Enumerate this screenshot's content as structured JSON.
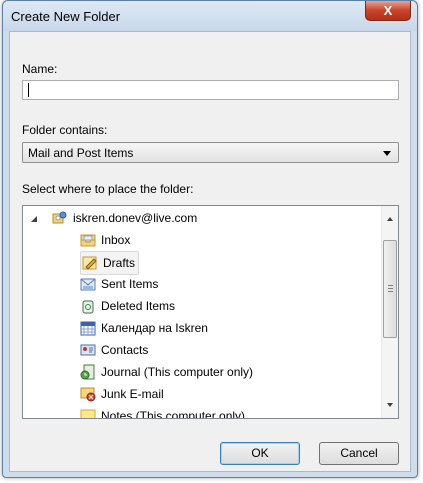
{
  "window": {
    "title": "Create New Folder",
    "close_label": "X"
  },
  "name_field": {
    "label": "Name:",
    "value": ""
  },
  "folder_contains": {
    "label": "Folder contains:",
    "selected": "Mail and Post Items"
  },
  "tree": {
    "label": "Select where to place the folder:",
    "root": {
      "label": "iskren.donev@live.com",
      "icon": "account-icon"
    },
    "items": [
      {
        "label": "Inbox",
        "icon": "inbox-icon"
      },
      {
        "label": "Drafts",
        "icon": "drafts-icon"
      },
      {
        "label": "Sent Items",
        "icon": "sent-items-icon"
      },
      {
        "label": "Deleted Items",
        "icon": "deleted-items-icon"
      },
      {
        "label": "Календар на Iskren",
        "icon": "calendar-icon"
      },
      {
        "label": "Contacts",
        "icon": "contacts-icon"
      },
      {
        "label": "Journal (This computer only)",
        "icon": "journal-icon"
      },
      {
        "label": "Junk E-mail",
        "icon": "junk-email-icon"
      },
      {
        "label": "Notes (This computer only)",
        "icon": "notes-icon"
      }
    ]
  },
  "buttons": {
    "ok": "OK",
    "cancel": "Cancel"
  }
}
